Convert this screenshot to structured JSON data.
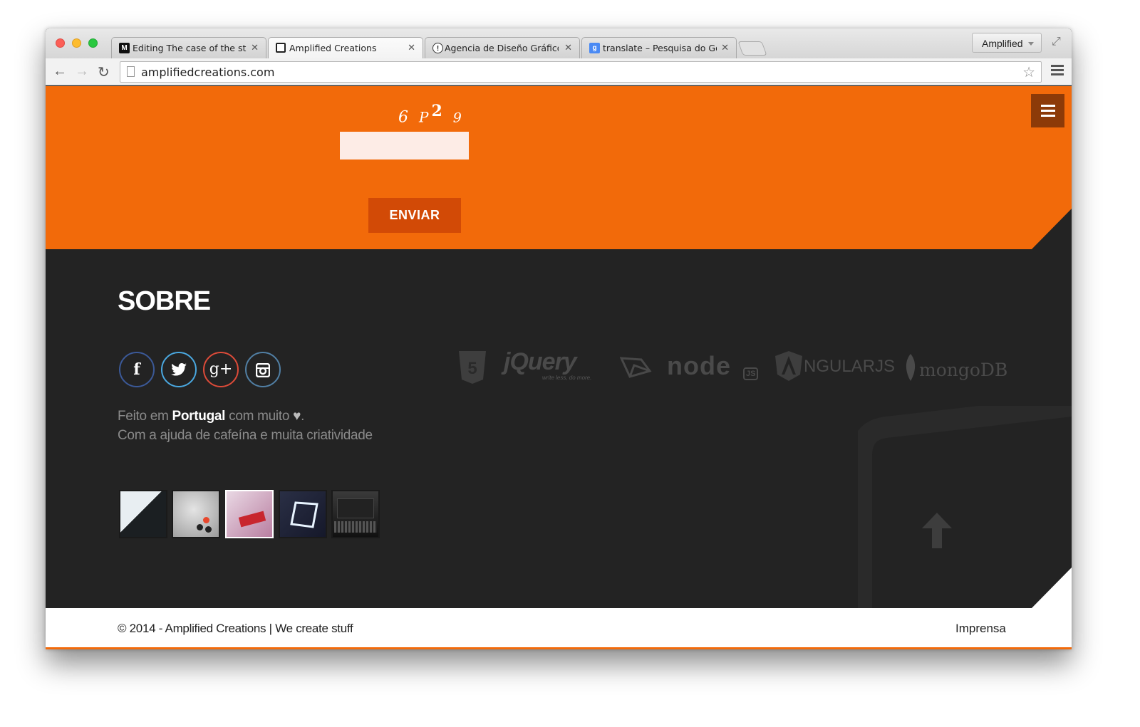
{
  "browser": {
    "tabs": [
      {
        "title": "Editing The case of the ste",
        "favicon": "M",
        "favicon_color": "#111111"
      },
      {
        "title": "Amplified Creations",
        "favicon": "",
        "favicon_color": "#222222"
      },
      {
        "title": "Agencia de Diseño Gráfico",
        "favicon": "!",
        "favicon_color": "#ffffff"
      },
      {
        "title": "translate – Pesquisa do Go",
        "favicon": "g",
        "favicon_color": "#4a8af4"
      }
    ],
    "profile": "Amplified",
    "url": "amplifiedcreations.com"
  },
  "form": {
    "captcha": "6 P2 9",
    "submit_label": "ENVIAR"
  },
  "about": {
    "title": "SOBRE",
    "social": [
      {
        "name": "facebook",
        "glyph": "f",
        "color": "#3b5998"
      },
      {
        "name": "twitter",
        "glyph": "t",
        "color": "#4aa8e0"
      },
      {
        "name": "google-plus",
        "glyph": "g+",
        "color": "#dd4b39"
      },
      {
        "name": "instagram",
        "glyph": "◘",
        "color": "#517fa4"
      }
    ],
    "made_prefix": "Feito em ",
    "made_country": "Portugal",
    "made_suffix": " com muito ",
    "made_heart": "♥",
    "made_end": ".",
    "help_line": "Com a ajuda de cafeína e muita criatividade"
  },
  "tech": [
    "5",
    "jQuery",
    "write less, do more.",
    "node",
    "JS",
    "NGULARJS",
    "mongoDB"
  ],
  "footer": {
    "copyright": "© 2014 - Amplified Creations | We create stuff",
    "press": "Imprensa"
  },
  "colors": {
    "accent": "#f26a0a",
    "dark": "#232323",
    "button": "#d24a06"
  }
}
